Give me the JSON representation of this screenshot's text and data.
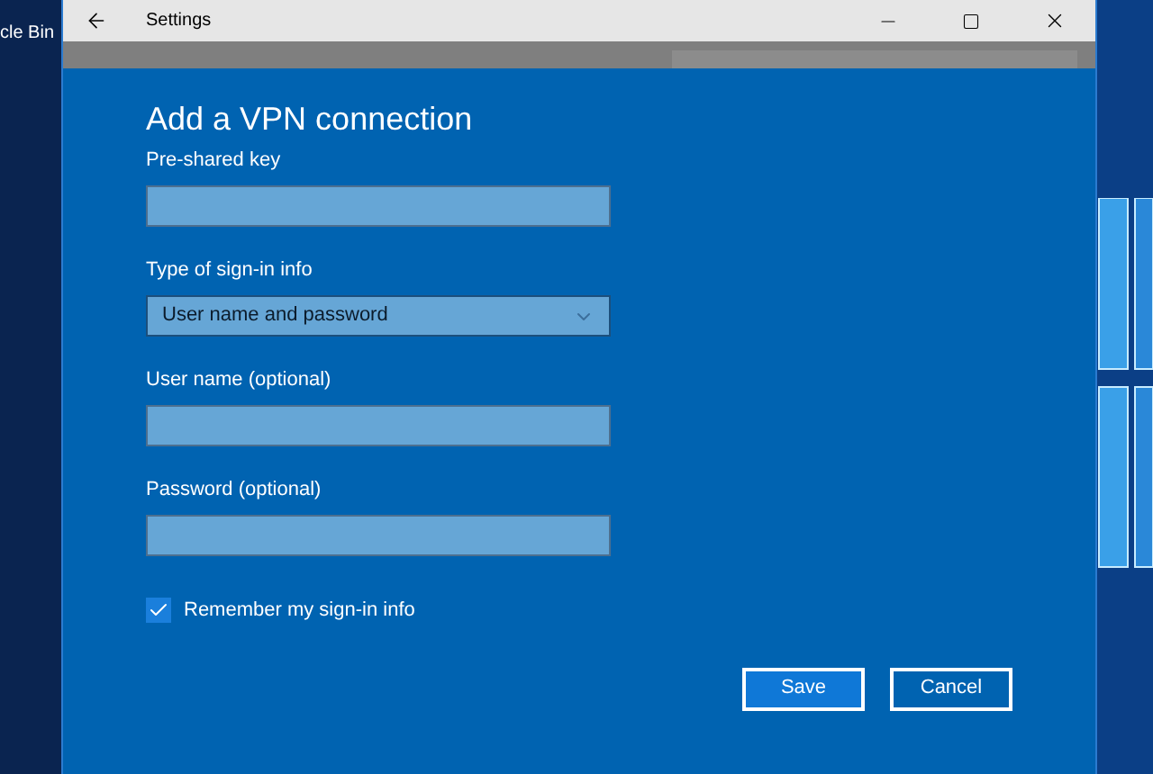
{
  "desktop": {
    "icon_label": "cle Bin"
  },
  "window": {
    "title": "Settings"
  },
  "dialog": {
    "title": "Add a VPN connection",
    "fields": [
      {
        "kind": "text",
        "label": "Pre-shared key"
      },
      {
        "kind": "select",
        "label": "Type of sign-in info",
        "value": "User name and password"
      },
      {
        "kind": "text",
        "label": "User name (optional)"
      },
      {
        "kind": "text",
        "label": "Password (optional)"
      }
    ],
    "remember": {
      "label": "Remember my sign-in info",
      "checked": true
    },
    "buttons": [
      "Save",
      "Cancel"
    ]
  }
}
